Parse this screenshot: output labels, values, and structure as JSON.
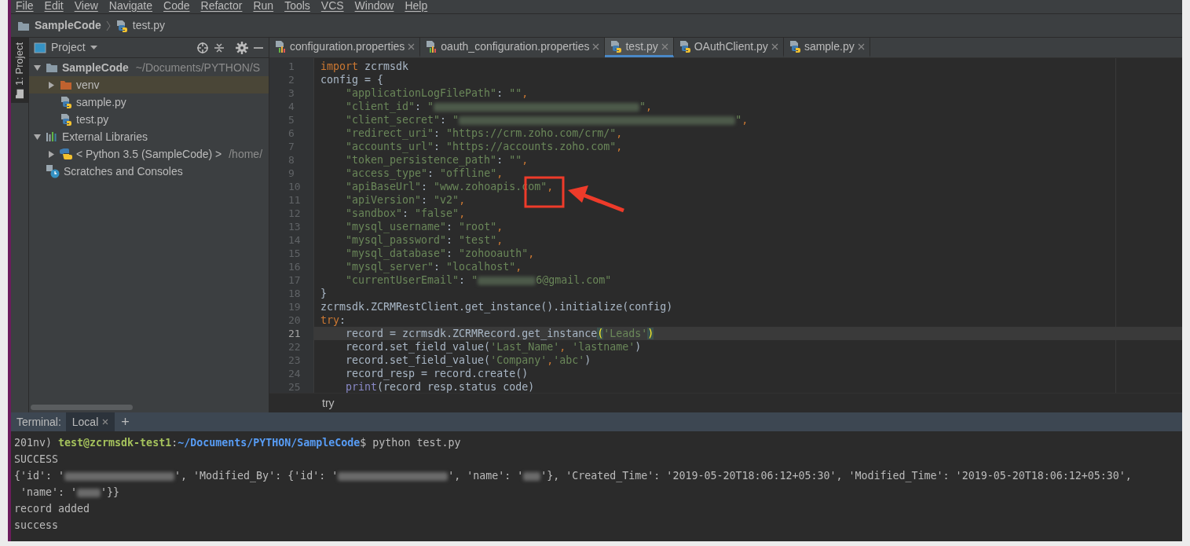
{
  "menu": [
    "File",
    "Edit",
    "View",
    "Navigate",
    "Code",
    "Refactor",
    "Run",
    "Tools",
    "VCS",
    "Window",
    "Help"
  ],
  "breadcrumb": [
    {
      "label": "SampleCode",
      "kind": "folder"
    },
    {
      "label": "test.py",
      "kind": "python"
    }
  ],
  "tool_strip": {
    "label": "1: Project",
    "selected": true
  },
  "project_panel": {
    "title": "Project",
    "tree": [
      {
        "label": "SampleCode",
        "detail": "~/Documents/PYTHON/S",
        "kind": "folder",
        "expanded": true,
        "selected": false,
        "children": [
          {
            "label": "venv",
            "kind": "venv",
            "expanded": false,
            "selected": true
          },
          {
            "label": "sample.py",
            "kind": "python",
            "selected": false
          },
          {
            "label": "test.py",
            "kind": "python",
            "selected": false
          }
        ]
      },
      {
        "label": "External Libraries",
        "kind": "libraries",
        "expanded": true,
        "selected": false,
        "children": [
          {
            "label": "< Python 3.5 (SampleCode) >",
            "detail": "/home/",
            "kind": "sdk",
            "expanded": false,
            "selected": false
          }
        ]
      },
      {
        "label": "Scratches and Consoles",
        "kind": "scratches",
        "selected": false
      }
    ]
  },
  "editor": {
    "tabs": [
      {
        "label": "configuration.properties",
        "kind": "properties",
        "selected": false
      },
      {
        "label": "oauth_configuration.properties",
        "kind": "properties",
        "selected": false
      },
      {
        "label": "test.py",
        "kind": "python",
        "selected": true
      },
      {
        "label": "OAuthClient.py",
        "kind": "python",
        "selected": false
      },
      {
        "label": "sample.py",
        "kind": "python",
        "selected": false
      }
    ],
    "lines": [
      {
        "number": "1",
        "current": false,
        "indent": false,
        "tokens": [
          {
            "kind": "kw",
            "text": "import"
          },
          {
            "kind": "plain",
            "text": " zcrmsdk"
          }
        ]
      },
      {
        "number": "2",
        "current": false,
        "indent": false,
        "tokens": [
          {
            "kind": "plain",
            "text": "config = {"
          }
        ]
      },
      {
        "number": "3",
        "current": false,
        "indent": true,
        "tokens": [
          {
            "kind": "str",
            "text": "\"applicationLogFilePath\""
          },
          {
            "kind": "plain",
            "text": ": "
          },
          {
            "kind": "str",
            "text": "\"\""
          },
          {
            "kind": "kw",
            "text": ","
          }
        ]
      },
      {
        "number": "4",
        "current": false,
        "indent": true,
        "tokens": [
          {
            "kind": "str",
            "text": "\"client_id\""
          },
          {
            "kind": "plain",
            "text": ": "
          },
          {
            "kind": "str",
            "text": "\""
          },
          {
            "kind": "redacted"
          },
          {
            "kind": "str",
            "text": "\""
          },
          {
            "kind": "kw",
            "text": ","
          }
        ]
      },
      {
        "number": "5",
        "current": false,
        "indent": true,
        "tokens": [
          {
            "kind": "str",
            "text": "\"client_secret\""
          },
          {
            "kind": "plain",
            "text": ": "
          },
          {
            "kind": "str",
            "text": "\""
          },
          {
            "kind": "redacted"
          },
          {
            "kind": "str",
            "text": "\""
          },
          {
            "kind": "kw",
            "text": ","
          }
        ]
      },
      {
        "number": "6",
        "current": false,
        "indent": true,
        "tokens": [
          {
            "kind": "str",
            "text": "\"redirect_uri\""
          },
          {
            "kind": "plain",
            "text": ": "
          },
          {
            "kind": "str",
            "text": "\"https://crm.zoho.com/crm/\""
          },
          {
            "kind": "kw",
            "text": ","
          }
        ]
      },
      {
        "number": "7",
        "current": false,
        "indent": true,
        "tokens": [
          {
            "kind": "str",
            "text": "\"accounts_url\""
          },
          {
            "kind": "plain",
            "text": ": "
          },
          {
            "kind": "str",
            "text": "\"https://accounts.zoho.com\""
          },
          {
            "kind": "kw",
            "text": ","
          }
        ]
      },
      {
        "number": "8",
        "current": false,
        "indent": true,
        "tokens": [
          {
            "kind": "str",
            "text": "\"token_persistence_path\""
          },
          {
            "kind": "plain",
            "text": ": "
          },
          {
            "kind": "str",
            "text": "\"\""
          },
          {
            "kind": "kw",
            "text": ","
          }
        ]
      },
      {
        "number": "9",
        "current": false,
        "indent": true,
        "tokens": [
          {
            "kind": "str",
            "text": "\"access_type\""
          },
          {
            "kind": "plain",
            "text": ": "
          },
          {
            "kind": "str",
            "text": "\"offline\""
          },
          {
            "kind": "kw",
            "text": ","
          }
        ]
      },
      {
        "number": "10",
        "current": false,
        "indent": true,
        "tokens": [
          {
            "kind": "str",
            "text": "\"apiBaseUrl\""
          },
          {
            "kind": "plain",
            "text": ": "
          },
          {
            "kind": "str",
            "text": "\"www.zohoapis.com\""
          },
          {
            "kind": "kw",
            "text": ","
          }
        ]
      },
      {
        "number": "11",
        "current": false,
        "indent": true,
        "tokens": [
          {
            "kind": "str",
            "text": "\"apiVersion\""
          },
          {
            "kind": "plain",
            "text": ": "
          },
          {
            "kind": "str",
            "text": "\"v2\""
          },
          {
            "kind": "kw",
            "text": ","
          }
        ]
      },
      {
        "number": "12",
        "current": false,
        "indent": true,
        "tokens": [
          {
            "kind": "str",
            "text": "\"sandbox\""
          },
          {
            "kind": "plain",
            "text": ": "
          },
          {
            "kind": "str",
            "text": "\"false\""
          },
          {
            "kind": "kw",
            "text": ","
          }
        ]
      },
      {
        "number": "13",
        "current": false,
        "indent": true,
        "tokens": [
          {
            "kind": "str",
            "text": "\"mysql_username\""
          },
          {
            "kind": "plain",
            "text": ": "
          },
          {
            "kind": "str",
            "text": "\"root\""
          },
          {
            "kind": "kw",
            "text": ","
          }
        ]
      },
      {
        "number": "14",
        "current": false,
        "indent": true,
        "tokens": [
          {
            "kind": "str",
            "text": "\"mysql_password\""
          },
          {
            "kind": "plain",
            "text": ": "
          },
          {
            "kind": "str",
            "text": "\"test\""
          },
          {
            "kind": "kw",
            "text": ","
          }
        ]
      },
      {
        "number": "15",
        "current": false,
        "indent": true,
        "tokens": [
          {
            "kind": "str",
            "text": "\"mysql_database\""
          },
          {
            "kind": "plain",
            "text": ": "
          },
          {
            "kind": "str",
            "text": "\"zohooauth\""
          },
          {
            "kind": "kw",
            "text": ","
          }
        ]
      },
      {
        "number": "16",
        "current": false,
        "indent": true,
        "tokens": [
          {
            "kind": "str",
            "text": "\"mysql_server\""
          },
          {
            "kind": "plain",
            "text": ": "
          },
          {
            "kind": "str",
            "text": "\"localhost\""
          },
          {
            "kind": "kw",
            "text": ","
          }
        ]
      },
      {
        "number": "17",
        "current": false,
        "indent": true,
        "tokens": [
          {
            "kind": "str",
            "text": "\"currentUserEmail\""
          },
          {
            "kind": "plain",
            "text": ": "
          },
          {
            "kind": "str",
            "text": "\""
          },
          {
            "kind": "redacted"
          },
          {
            "kind": "str",
            "text": "6@gmail.com\""
          }
        ]
      },
      {
        "number": "18",
        "current": false,
        "indent": false,
        "tokens": [
          {
            "kind": "plain",
            "text": "}"
          }
        ]
      },
      {
        "number": "19",
        "current": false,
        "indent": false,
        "tokens": [
          {
            "kind": "plain",
            "text": "zcrmsdk.ZCRMRestClient.get_instance().initialize(config)"
          }
        ]
      },
      {
        "number": "20",
        "current": false,
        "indent": false,
        "tokens": [
          {
            "kind": "kw",
            "text": "try"
          },
          {
            "kind": "plain",
            "text": ":"
          }
        ]
      },
      {
        "number": "21",
        "current": true,
        "indent": true,
        "tokens": [
          {
            "kind": "plain",
            "text": "record = zcrmsdk.ZCRMRecord.get_instance"
          },
          {
            "kind": "brace",
            "text": "("
          },
          {
            "kind": "str",
            "text": "'Leads'"
          },
          {
            "kind": "brace",
            "text": ")"
          }
        ]
      },
      {
        "number": "22",
        "current": false,
        "indent": true,
        "tokens": [
          {
            "kind": "plain",
            "text": "record.set_field_value("
          },
          {
            "kind": "str",
            "text": "'Last_Name'"
          },
          {
            "kind": "kw",
            "text": ", "
          },
          {
            "kind": "str",
            "text": "'lastname'"
          },
          {
            "kind": "plain",
            "text": ")"
          }
        ]
      },
      {
        "number": "23",
        "current": false,
        "indent": true,
        "tokens": [
          {
            "kind": "plain",
            "text": "record.set_field_value("
          },
          {
            "kind": "str",
            "text": "'Company'"
          },
          {
            "kind": "kw",
            "text": ","
          },
          {
            "kind": "str",
            "text": "'abc'"
          },
          {
            "kind": "plain",
            "text": ")"
          }
        ]
      },
      {
        "number": "24",
        "current": false,
        "indent": true,
        "tokens": [
          {
            "kind": "plain",
            "text": "record_resp = record.create()"
          }
        ]
      },
      {
        "number": "25",
        "current": false,
        "indent": true,
        "tokens": [
          {
            "kind": "fn",
            "text": "print"
          },
          {
            "kind": "plain",
            "text": "(record_resp.status_code)"
          }
        ]
      }
    ],
    "footer": "try"
  },
  "terminal": {
    "label": "Terminal:",
    "tabs": [
      {
        "label": "Local",
        "selected": true
      }
    ],
    "add": "+",
    "lines": [
      {
        "tokens": [
          {
            "kind": "plain",
            "text": "201nv) "
          },
          {
            "kind": "user",
            "text": "test@zcrmsdk-test1"
          },
          {
            "kind": "plain",
            "text": ":"
          },
          {
            "kind": "path",
            "text": "~/Documents/PYTHON/SampleCode"
          },
          {
            "kind": "plain",
            "text": "$ python test.py"
          }
        ]
      },
      {
        "tokens": [
          {
            "kind": "plain",
            "text": "SUCCESS"
          }
        ]
      },
      {
        "tokens": [
          {
            "kind": "plain",
            "text": "{'id': '"
          },
          {
            "kind": "redacted"
          },
          {
            "kind": "plain",
            "text": "', 'Modified_By': {'id': '"
          },
          {
            "kind": "redacted"
          },
          {
            "kind": "plain",
            "text": "', 'name': '"
          },
          {
            "kind": "redacted"
          },
          {
            "kind": "plain",
            "text": "'}, 'Created_Time': '2019-05-20T18:06:12+05:30', 'Modified_Time': '2019-05-20T18:06:12+05:30',"
          }
        ]
      },
      {
        "tokens": [
          {
            "kind": "plain",
            "text": " 'name': '"
          },
          {
            "kind": "redacted"
          },
          {
            "kind": "plain",
            "text": "'}}"
          }
        ]
      },
      {
        "tokens": [
          {
            "kind": "plain",
            "text": "record added"
          }
        ]
      },
      {
        "tokens": [
          {
            "kind": "plain",
            "text": "success"
          }
        ]
      }
    ]
  }
}
